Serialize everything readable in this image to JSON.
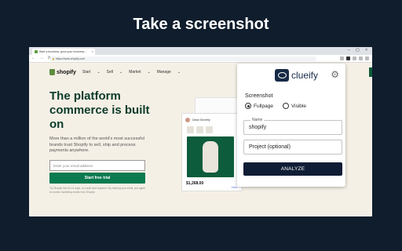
{
  "hero": {
    "title": "Take a screenshot"
  },
  "browser": {
    "tab_title": "Start a business, grow your business...",
    "tab_close": "×",
    "window_controls": "– ▢ ×",
    "nav_icons": "← → ⟳",
    "url": "https://www.shopify.com"
  },
  "site": {
    "logo_text": "shopify",
    "nav": [
      "Start",
      "Sell",
      "Market",
      "Manage"
    ],
    "headline": "The platform commerce is built on",
    "subtext": "More than a million of the world's most successful brands trust Shopify to sell, ship and process payments anywhere.",
    "email_placeholder": "Enter your email address",
    "trial_button": "Start free trial",
    "fineprint": "Try Shopify free for 14 days, no credit card required. By entering your email, you agree to receive marketing emails from Shopify.",
    "product": {
      "seller": "Dawn Secretly",
      "price": "$1,268.00",
      "link": "View"
    }
  },
  "extension": {
    "name": "clueify",
    "screenshot_label": "Screenshot",
    "options": [
      {
        "label": "Fullpage",
        "checked": true
      },
      {
        "label": "Visible",
        "checked": false
      }
    ],
    "name_field": {
      "legend": "Name",
      "value": "shopify"
    },
    "project_field": {
      "placeholder": "Project (optional)"
    },
    "analyze_button": "ANALYZE"
  }
}
